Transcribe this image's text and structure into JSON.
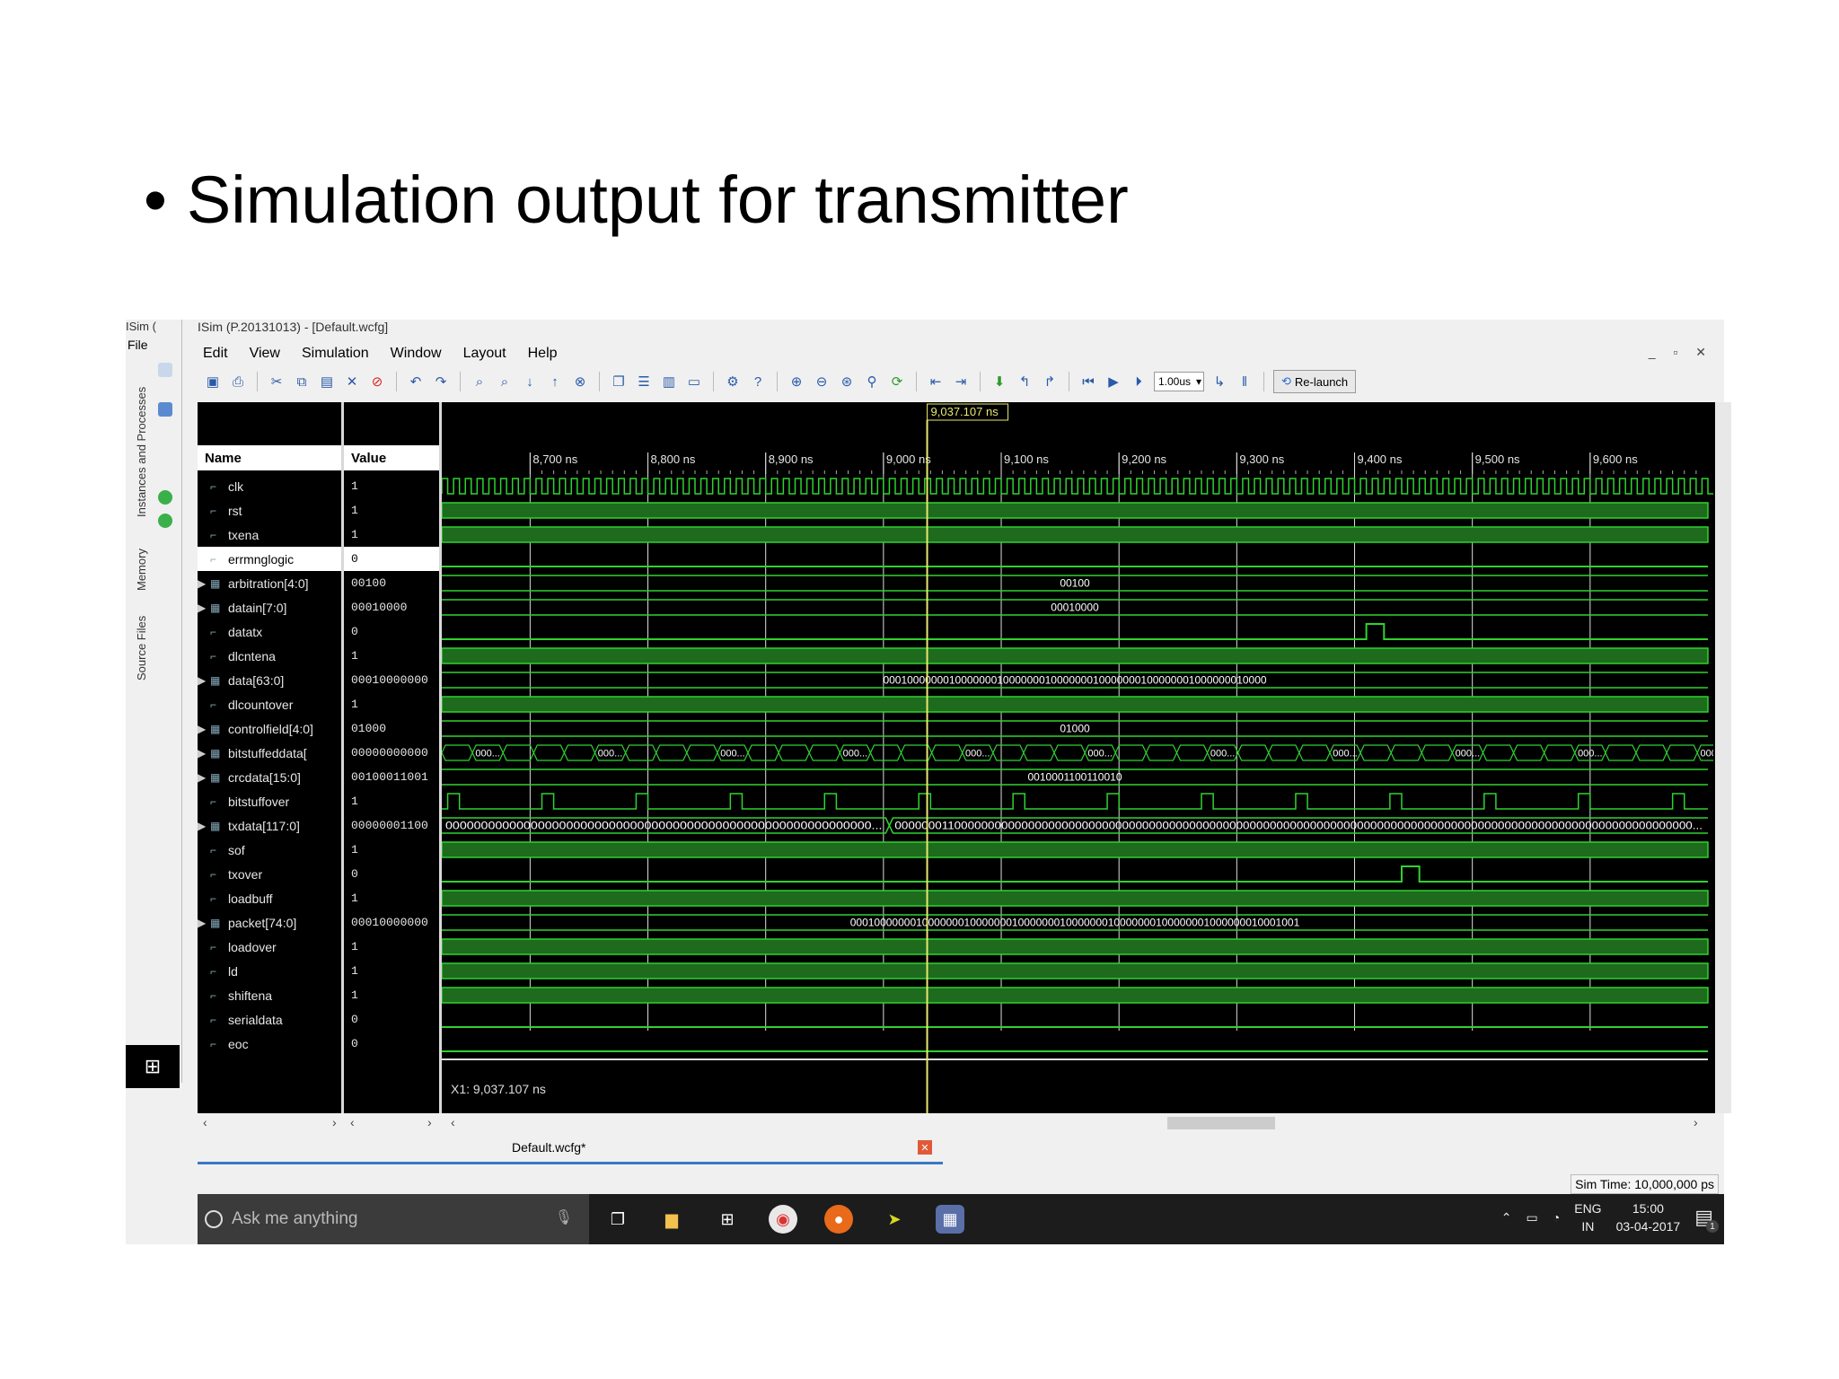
{
  "slide": {
    "bullet": "•",
    "heading": "Simulation output for transmitter"
  },
  "window": {
    "title": "ISim (P.20131013) - [Default.wcfg]",
    "left_title": "ISim (",
    "file_menu": "File",
    "side_tabs": [
      "Instances and Processes",
      "Memory",
      "Source Files"
    ],
    "window_controls": "_ ▫ ✕"
  },
  "menu": [
    "Edit",
    "View",
    "Simulation",
    "Window",
    "Layout",
    "Help"
  ],
  "toolbar": {
    "zoom_value": "1.00us",
    "relaunch_label": "Re-launch"
  },
  "wave": {
    "name_header": "Name",
    "value_header": "Value",
    "cursor_label": "9,037.107 ns",
    "cursor_readout": "X1: 9,037.107 ns",
    "time_ticks": [
      "8,700 ns",
      "8,800 ns",
      "8,900 ns",
      "9,000 ns",
      "9,100 ns",
      "9,200 ns",
      "9,300 ns",
      "9,400 ns",
      "9,500 ns",
      "9,600 ns"
    ],
    "signals": [
      {
        "name": "clk",
        "value": "1",
        "bus": false,
        "kind": "clock"
      },
      {
        "name": "rst",
        "value": "1",
        "bus": false,
        "kind": "high"
      },
      {
        "name": "txena",
        "value": "1",
        "bus": false,
        "kind": "high"
      },
      {
        "name": "errmnglogic",
        "value": "0",
        "bus": false,
        "kind": "low",
        "selected": true
      },
      {
        "name": "arbitration[4:0]",
        "value": "00100",
        "bus": true,
        "kind": "bus",
        "label": "00100"
      },
      {
        "name": "datain[7:0]",
        "value": "00010000",
        "bus": true,
        "kind": "bus",
        "label": "00010000"
      },
      {
        "name": "datatx",
        "value": "0",
        "bus": false,
        "kind": "pulse",
        "pulse_at": 9410
      },
      {
        "name": "dlcntena",
        "value": "1",
        "bus": false,
        "kind": "high"
      },
      {
        "name": "data[63:0]",
        "value": "00010000000",
        "bus": true,
        "kind": "bus",
        "label": "0001000000010000000100000001000000010000000100000001000000010000"
      },
      {
        "name": "dlcountover",
        "value": "1",
        "bus": false,
        "kind": "high"
      },
      {
        "name": "controlfield[4:0]",
        "value": "01000",
        "bus": true,
        "kind": "bus",
        "label": "01000"
      },
      {
        "name": "bitstuffeddata[",
        "value": "00000000000",
        "bus": true,
        "kind": "busseg",
        "label": "000..."
      },
      {
        "name": "crcdata[15:0]",
        "value": "00100011001",
        "bus": true,
        "kind": "bus",
        "label": "0010001100110010"
      },
      {
        "name": "bitstuffover",
        "value": "1",
        "bus": false,
        "kind": "pulses"
      },
      {
        "name": "txdata[117:0]",
        "value": "00000001100",
        "bus": true,
        "kind": "bus2",
        "label": "000000000000000000000000000000000000000000000000000000000000...",
        "label2": "00000001100000000000000000000000000000000000000000000000000000000000000000000000000000000000000000000000000000000000000..."
      },
      {
        "name": "sof",
        "value": "1",
        "bus": false,
        "kind": "high"
      },
      {
        "name": "txover",
        "value": "0",
        "bus": false,
        "kind": "pulse",
        "pulse_at": 9440
      },
      {
        "name": "loadbuff",
        "value": "1",
        "bus": false,
        "kind": "high"
      },
      {
        "name": "packet[74:0]",
        "value": "00010000000",
        "bus": true,
        "kind": "bus",
        "label": "000100000001000000010000000100000001000000010000000100000001000000010001001"
      },
      {
        "name": "loadover",
        "value": "1",
        "bus": false,
        "kind": "high"
      },
      {
        "name": "ld",
        "value": "1",
        "bus": false,
        "kind": "high"
      },
      {
        "name": "shiftena",
        "value": "1",
        "bus": false,
        "kind": "high"
      },
      {
        "name": "serialdata",
        "value": "0",
        "bus": false,
        "kind": "low"
      },
      {
        "name": "eoc",
        "value": "0",
        "bus": false,
        "kind": "low"
      }
    ],
    "time_start": 8625,
    "time_end": 9700,
    "cursor_time": 9037.107
  },
  "tabs": {
    "active": "Default.wcfg*"
  },
  "status": {
    "sim_time": "Sim Time: 10,000,000 ps"
  },
  "taskbar": {
    "search_placeholder": "Ask me anything",
    "lang": "ENG",
    "region": "IN",
    "time": "15:00",
    "date": "03-04-2017",
    "notifications": "1"
  },
  "colors": {
    "wave_green": "#2fd22f",
    "wave_fill": "#1e6b1e",
    "background": "#000000",
    "cursor": "#e8e870"
  }
}
